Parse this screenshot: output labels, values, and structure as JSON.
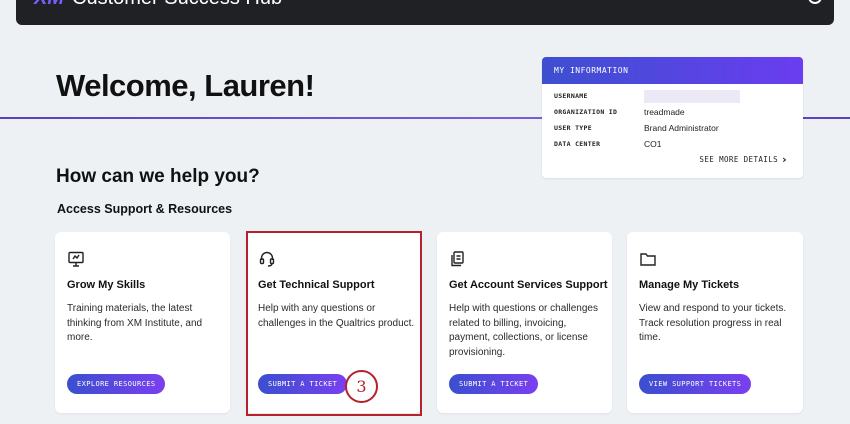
{
  "header": {
    "app_title": "Customer Success Hub"
  },
  "page": {
    "welcome": "Welcome, Lauren!",
    "help_heading": "How can we help you?",
    "section_heading": "Access Support & Resources"
  },
  "info": {
    "header": "MY INFORMATION",
    "rows": [
      {
        "label": "USERNAME",
        "value": ""
      },
      {
        "label": "ORGANIZATION ID",
        "value": "treadmade"
      },
      {
        "label": "USER TYPE",
        "value": "Brand Administrator"
      },
      {
        "label": "DATA CENTER",
        "value": "CO1"
      }
    ],
    "see_more": "SEE MORE DETAILS"
  },
  "cards": [
    {
      "icon": "monitor-icon",
      "title": "Grow My Skills",
      "desc": "Training materials, the latest thinking from XM Institute, and more.",
      "button": "EXPLORE RESOURCES"
    },
    {
      "icon": "headset-icon",
      "title": "Get Technical Support",
      "desc": "Help with any questions or challenges in the Qualtrics product.",
      "button": "SUBMIT A TICKET"
    },
    {
      "icon": "documents-icon",
      "title": "Get Account Services Support",
      "desc": "Help with questions or challenges related to billing, invoicing, payment, collections, or license provisioning.",
      "button": "SUBMIT A TICKET"
    },
    {
      "icon": "folder-icon",
      "title": "Manage My Tickets",
      "desc": "View and respond to your tickets. Track resolution progress in real time.",
      "button": "VIEW SUPPORT TICKETS"
    }
  ],
  "annotation": {
    "step": "3",
    "color": "#b5222c"
  },
  "colors": {
    "accent_start": "#3a4fcf",
    "accent_end": "#7a3ff0",
    "background": "#edf1f4"
  }
}
